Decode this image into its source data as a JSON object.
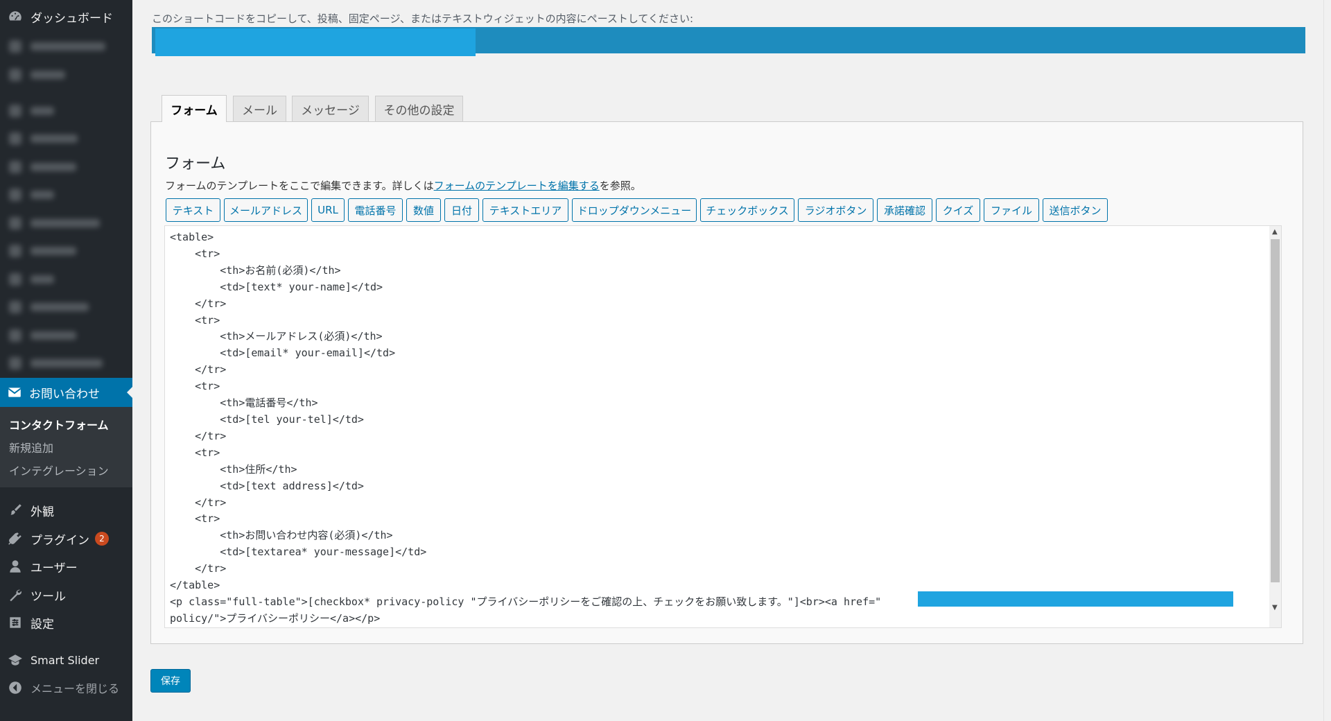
{
  "sidebar": {
    "dashboard": "ダッシュボード",
    "contact": "お問い合わせ",
    "submenu": [
      "コンタクトフォーム",
      "新規追加",
      "インテグレーション"
    ],
    "appearance": "外観",
    "plugins": "プラグイン",
    "plugins_badge": "2",
    "users": "ユーザー",
    "tools": "ツール",
    "settings": "設定",
    "smart_slider": "Smart Slider",
    "collapse": "メニューを閉じる"
  },
  "shortcode": {
    "hint": "このショートコードをコピーして、投稿、固定ページ、またはテキストウィジェットの内容にペーストしてください:"
  },
  "tabs": [
    "フォーム",
    "メール",
    "メッセージ",
    "その他の設定"
  ],
  "form": {
    "title": "フォーム",
    "desc_before": "フォームのテンプレートをここで編集できます。詳しくは",
    "desc_link": "フォームのテンプレートを編集する",
    "desc_after": "を参照。",
    "tag_buttons": [
      "テキスト",
      "メールアドレス",
      "URL",
      "電話番号",
      "数値",
      "日付",
      "テキストエリア",
      "ドロップダウンメニュー",
      "チェックボックス",
      "ラジオボタン",
      "承諾確認",
      "クイズ",
      "ファイル",
      "送信ボタン"
    ],
    "code": "<table>\n    <tr>\n        <th>お名前(必須)</th>\n        <td>[text* your-name]</td>\n    </tr>\n    <tr>\n        <th>メールアドレス(必須)</th>\n        <td>[email* your-email]</td>\n    </tr>\n    <tr>\n        <th>電話番号</th>\n        <td>[tel your-tel]</td>\n    </tr>\n    <tr>\n        <th>住所</th>\n        <td>[text address]</td>\n    </tr>\n    <tr>\n        <th>お問い合わせ内容(必須)</th>\n        <td>[textarea* your-message]</td>\n    </tr>\n</table>\n<p class=\"full-table\">[checkbox* privacy-policy \"プライバシーポリシーをご確認の上、チェックをお願い致します。\"]<br><a href=\"\npolicy/\">プライバシーポリシー</a></p>"
  },
  "save_label": "保存"
}
